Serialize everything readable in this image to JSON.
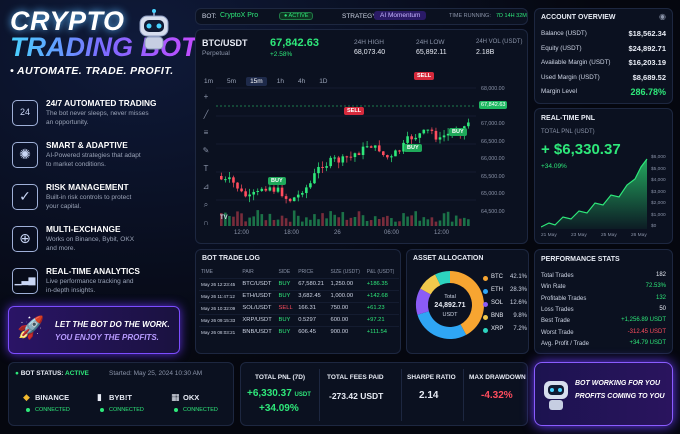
{
  "brand": {
    "line1": "CRYPTO",
    "line2": "TRADING BOT",
    "tagline": "• AUTOMATE. TRADE. PROFIT."
  },
  "features": [
    {
      "icon": "clock-24-icon",
      "glyph": "24",
      "title": "24/7 AUTOMATED TRADING",
      "desc1": "The bot never sleeps, never misses",
      "desc2": "an opportunity."
    },
    {
      "icon": "brain-icon",
      "glyph": "✺",
      "title": "SMART & ADAPTIVE",
      "desc1": "AI-Powered strategies that adapt",
      "desc2": "to market conditions."
    },
    {
      "icon": "shield-icon",
      "glyph": "✓",
      "title": "RISK MANAGEMENT",
      "desc1": "Built-in risk controls to protect",
      "desc2": "your capital."
    },
    {
      "icon": "network-icon",
      "glyph": "⊕",
      "title": "MULTI-EXCHANGE",
      "desc1": "Works on Binance, Bybit, OKX",
      "desc2": "and more."
    },
    {
      "icon": "analytics-icon",
      "glyph": "▁▃▆",
      "title": "REAL-TIME ANALYTICS",
      "desc1": "Live performance tracking and",
      "desc2": "in-depth insights."
    }
  ],
  "promo": {
    "line1": "LET THE BOT DO THE WORK.",
    "line2": "YOU ENJOY THE PROFITS."
  },
  "topbar": {
    "bot_label": "BOT:",
    "bot_name": "CryptoX Pro",
    "active": "ACTIVE",
    "strategy_label": "STRATEGY:",
    "strategy": "AI Momentum",
    "time_label": "TIME RUNNING:",
    "time": "7D 14H 32M"
  },
  "ticker": {
    "pair": "BTC/USDT",
    "type": "Perpetual",
    "price": "67,842.63",
    "change": "+2.58%",
    "high_label": "24H HIGH",
    "high": "68,073.40",
    "low_label": "24H LOW",
    "low": "65,892.11",
    "vol_label": "24H VOL (USDT)",
    "vol": "2.18B"
  },
  "timeframes": [
    "1m",
    "5m",
    "15m",
    "1h",
    "4h",
    "1D"
  ],
  "chart_axis": {
    "x": [
      "12:00",
      "18:00",
      "26",
      "06:00",
      "12:00"
    ],
    "y": [
      "68,000.00",
      "67,500.00",
      "67,000.00",
      "66,500.00",
      "66,000.00",
      "65,500.00",
      "65,000.00",
      "64,500.00"
    ],
    "price_tag": "67,842.63"
  },
  "signals": {
    "sell": "SELL",
    "buy": "BUY"
  },
  "account": {
    "title": "ACCOUNT OVERVIEW",
    "rows": [
      {
        "k": "Balance (USDT)",
        "v": "$18,562.34"
      },
      {
        "k": "Equity (USDT)",
        "v": "$24,892.71"
      },
      {
        "k": "Available Margin (USDT)",
        "v": "$16,203.19"
      },
      {
        "k": "Used Margin (USDT)",
        "v": "$8,689.52"
      },
      {
        "k": "Margin Level",
        "v": "286.78%"
      }
    ]
  },
  "pnl": {
    "title": "REAL-TIME PNL",
    "sub": "TOTAL PNL (USDT)",
    "value": "+ $6,330.37",
    "pct": "+34.09%",
    "x": [
      "21 May",
      "23 May",
      "25 May",
      "26 May"
    ],
    "y": [
      "$6,000",
      "$5,000",
      "$4,000",
      "$3,000",
      "$2,000",
      "$1,000",
      "$0"
    ]
  },
  "tradelog": {
    "title": "BOT TRADE LOG",
    "headers": [
      "TIME",
      "PAIR",
      "SIDE",
      "PRICE",
      "SIZE (USDT)",
      "P&L (USDT)"
    ],
    "rows": [
      [
        "May 26 12:23:45",
        "BTC/USDT",
        "BUY",
        "67,580.21",
        "1,250.00",
        "+186.35"
      ],
      [
        "May 26 11:47:12",
        "ETH/USDT",
        "BUY",
        "3,682.45",
        "1,000.00",
        "+142.68"
      ],
      [
        "May 26 10:32:09",
        "SOL/USDT",
        "SELL",
        "166.31",
        "750.00",
        "+61.23"
      ],
      [
        "May 26 09:15:33",
        "XRP/USDT",
        "BUY",
        "0.5297",
        "600.00",
        "+97.21"
      ],
      [
        "May 26 08:03:21",
        "BNB/USDT",
        "BUY",
        "606.45",
        "900.00",
        "+111.54"
      ]
    ]
  },
  "allocation": {
    "title": "ASSET ALLOCATION",
    "center_label": "Total",
    "center_value": "24,892.71",
    "center_unit": "USDT",
    "items": [
      {
        "name": "BTC",
        "pct": "42.1%",
        "val": 42.1,
        "color": "#f7a531"
      },
      {
        "name": "ETH",
        "pct": "28.3%",
        "val": 28.3,
        "color": "#2fa6f5"
      },
      {
        "name": "SOL",
        "pct": "12.6%",
        "val": 12.6,
        "color": "#8b5cf6"
      },
      {
        "name": "BNB",
        "pct": "9.8%",
        "val": 9.8,
        "color": "#f2c94c"
      },
      {
        "name": "XRP",
        "pct": "7.2%",
        "val": 7.2,
        "color": "#2dd4bf"
      }
    ]
  },
  "perf": {
    "title": "PERFORMANCE STATS",
    "rows": [
      {
        "k": "Total Trades",
        "v": "182",
        "c": "#e8ecf5"
      },
      {
        "k": "Win Rate",
        "v": "72.53%",
        "c": "#2ee87a"
      },
      {
        "k": "Profitable Trades",
        "v": "132",
        "c": "#2ee87a"
      },
      {
        "k": "Loss Trades",
        "v": "50",
        "c": "#e8ecf5"
      },
      {
        "k": "Best Trade",
        "v": "+1,256.89 USDT",
        "c": "#2ee87a"
      },
      {
        "k": "Worst Trade",
        "v": "-312.45 USDT",
        "c": "#ff4d5e"
      },
      {
        "k": "Avg. Profit / Trade",
        "v": "+34.79 USDT",
        "c": "#2ee87a"
      }
    ]
  },
  "status": {
    "label": "BOT STATUS:",
    "value": "ACTIVE",
    "started": "Started: May 25, 2024 10:30 AM",
    "exchanges": [
      {
        "name": "BINANCE",
        "state": "CONNECTED"
      },
      {
        "name": "BYB!T",
        "state": "CONNECTED"
      },
      {
        "name": "OKX",
        "state": "CONNECTED"
      }
    ]
  },
  "summary": {
    "pnl_label": "TOTAL PNL (7D)",
    "pnl": "+6,330.37",
    "pnl_unit": "USDT",
    "pnl_pct": "+34.09%",
    "fees_label": "TOTAL FEES PAID",
    "fees": "-273.42 USDT",
    "sharpe_label": "SHARPE RATIO",
    "sharpe": "2.14",
    "dd_label": "MAX DRAWDOWN",
    "dd": "-4.32%"
  },
  "cta": {
    "line1": "BOT WORKING FOR YOU",
    "line2": "PROFITS COMING TO YOU"
  }
}
